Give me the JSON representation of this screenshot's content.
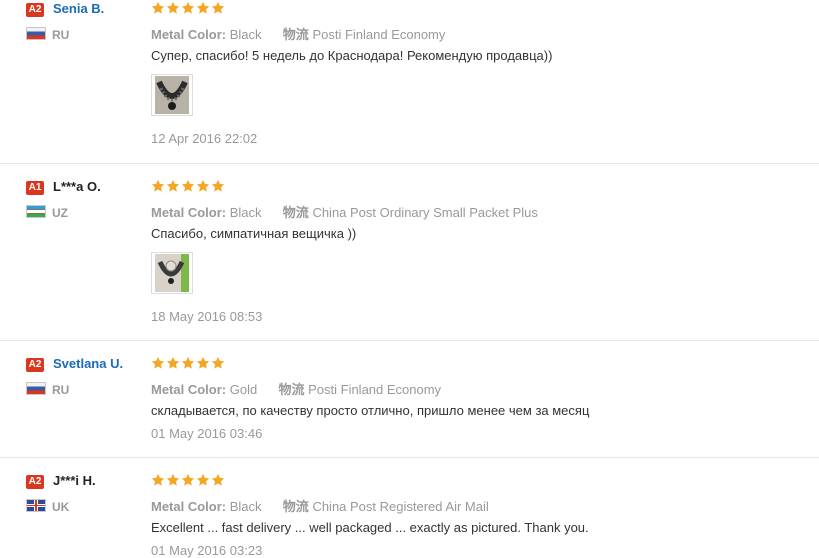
{
  "reviews": [
    {
      "level": "A2",
      "name": "Senia B.",
      "country": "RU",
      "rating": 5,
      "metal_label": "Metal Color:",
      "metal_value": "Black",
      "shipping_label": "物流",
      "shipping_value": "Posti Finland Economy",
      "text": "Супер, спасибо! 5 недель до Краснодара! Рекомендую продавца))",
      "has_photo": true,
      "date": "12 Apr 2016 22:02"
    },
    {
      "level": "A1",
      "name": "L***a O.",
      "country": "UZ",
      "rating": 5,
      "metal_label": "Metal Color:",
      "metal_value": "Black",
      "shipping_label": "物流",
      "shipping_value": "China Post Ordinary Small Packet Plus",
      "text": "Спасибо, симпатичная вещичка ))",
      "has_photo": true,
      "date": "18 May 2016 08:53"
    },
    {
      "level": "A2",
      "name": "Svetlana U.",
      "country": "RU",
      "rating": 5,
      "metal_label": "Metal Color:",
      "metal_value": "Gold",
      "shipping_label": "物流",
      "shipping_value": "Posti Finland Economy",
      "text": "складывается, по качеству просто отлично, пришло менее чем за месяц",
      "has_photo": false,
      "date": "01 May 2016 03:46"
    },
    {
      "level": "A2",
      "name": "J***i H.",
      "country": "UK",
      "rating": 5,
      "metal_label": "Metal Color:",
      "metal_value": "Black",
      "shipping_label": "物流",
      "shipping_value": "China Post Registered Air Mail",
      "text": "Excellent ... fast delivery ... well packaged ... exactly as pictured. Thank you.",
      "has_photo": false,
      "date": "01 May 2016 03:23"
    }
  ],
  "colors": {
    "badge": "#d9381e",
    "star": "#f5a623",
    "link_name": "#1a6bb8",
    "muted": "#999999"
  }
}
